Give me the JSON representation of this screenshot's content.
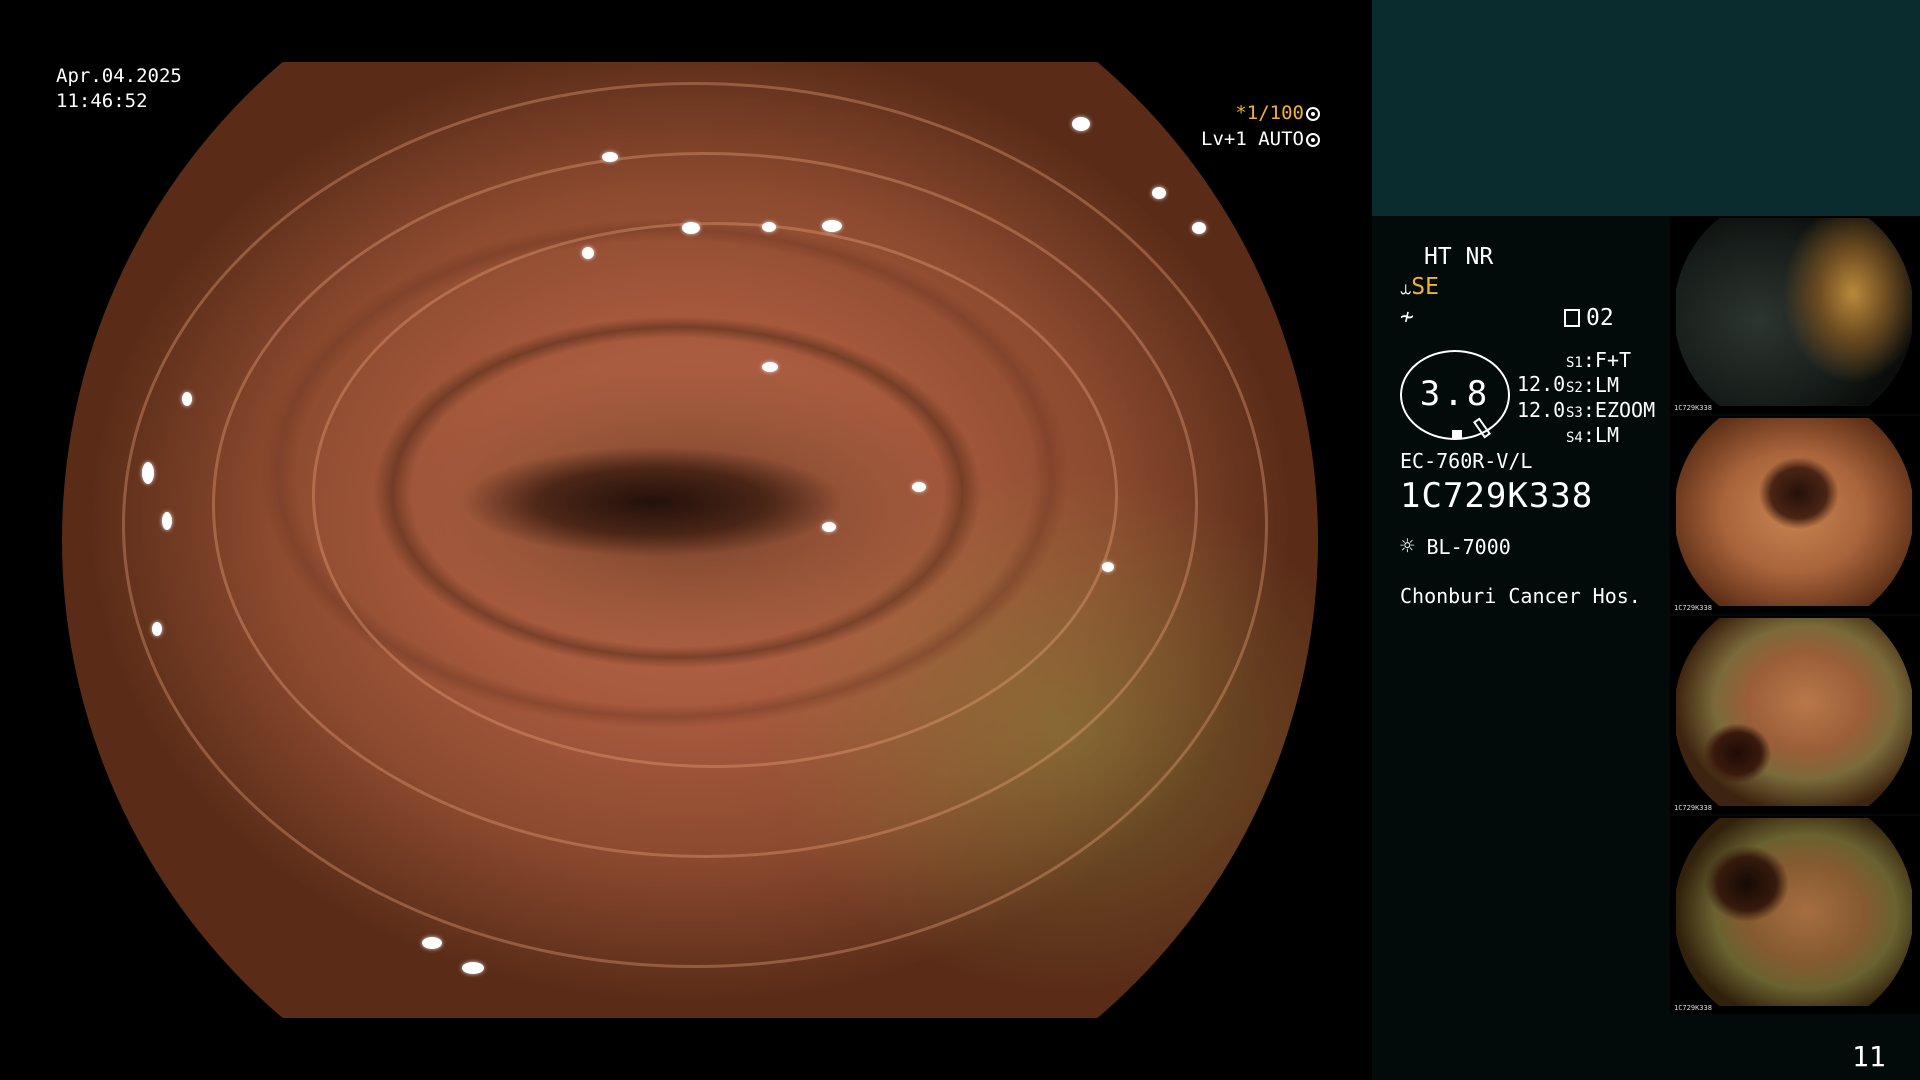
{
  "overlay": {
    "date": "Apr.04.2025",
    "time": "11:46:52",
    "shutter": "*1/100",
    "mode": "Lv+1 AUTO"
  },
  "panel": {
    "structure": "HT NR",
    "color_mode": "SE",
    "freeze_label": "02",
    "gauge_value": "3.8",
    "value_a": "12.0",
    "value_b": "12.0",
    "switches": [
      {
        "label": "S1",
        "value": "F+T"
      },
      {
        "label": "S2",
        "value": "LM"
      },
      {
        "label": "S3",
        "value": "EZOOM"
      },
      {
        "label": "S4",
        "value": "LM"
      }
    ],
    "scope_model": "EC-760R-V/L",
    "serial": "1C729K338",
    "light_source": "BL-7000",
    "hospital": "Chonburi Cancer Hos.",
    "page_number": "11"
  },
  "thumbnails": [
    {
      "caption": "1C729K338"
    },
    {
      "caption": "1C729K338"
    },
    {
      "caption": "1C729K338"
    },
    {
      "caption": "1C729K338"
    }
  ],
  "colors": {
    "accent_yellow": "#f2b233",
    "panel_header": "#0b2c2e",
    "panel_body": "#030a0a"
  }
}
